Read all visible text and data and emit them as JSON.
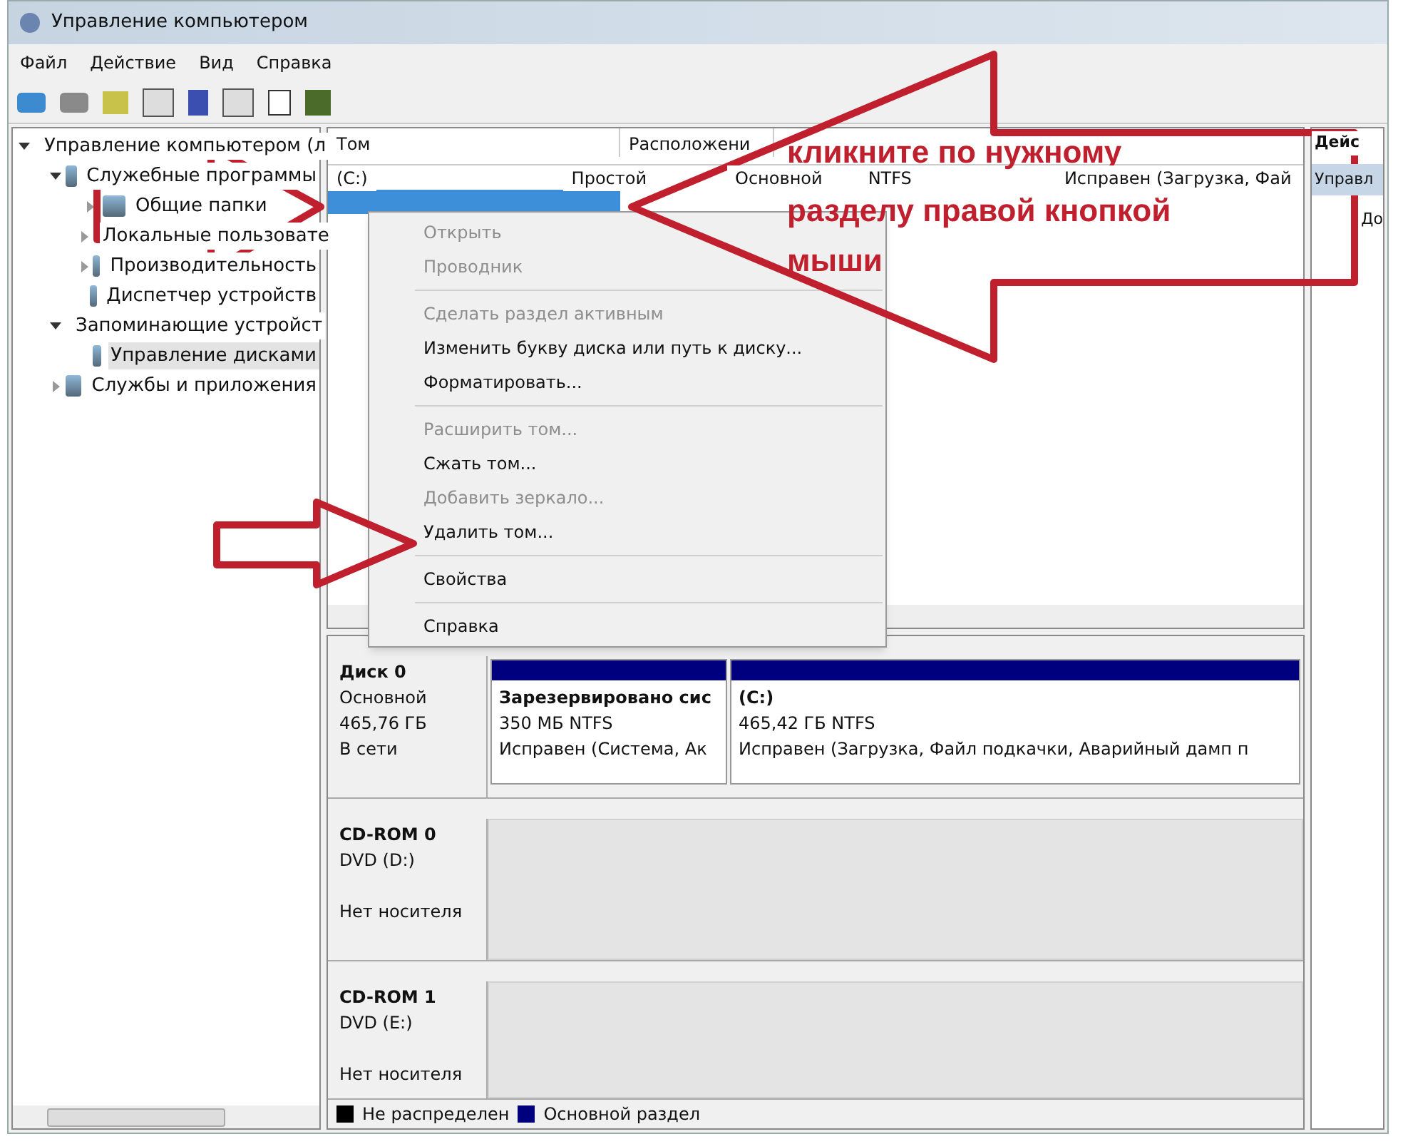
{
  "window": {
    "title": "Управление компьютером"
  },
  "menu_bar": [
    "Файл",
    "Действие",
    "Вид",
    "Справка"
  ],
  "tree": [
    {
      "label": "Управление компьютером (л",
      "expanded": true,
      "children": [
        {
          "label": "Служебные программы",
          "expanded": true,
          "children": [
            {
              "label": "Общие папки",
              "expanded": false
            },
            {
              "label": "Локальные пользовате",
              "expanded": false
            },
            {
              "label": "Производительность",
              "expanded": false
            },
            {
              "label": "Диспетчер устройств"
            }
          ]
        },
        {
          "label": "Запоминающие устройст",
          "expanded": true,
          "children": [
            {
              "label": "Управление дисками",
              "selected": true
            }
          ]
        },
        {
          "label": "Службы и приложения",
          "expanded": false
        }
      ]
    }
  ],
  "volume_table": {
    "columns": [
      "Том",
      "Расположени"
    ],
    "rows": [
      {
        "cells": [
          "(C:)",
          "Простой",
          "Основной",
          "NTFS",
          "Исправен (Загрузка, Фай"
        ],
        "selected": false
      },
      {
        "cells": [],
        "selected": true
      }
    ]
  },
  "actions_panel": {
    "title": "Дейс",
    "items": [
      "Управл",
      "До"
    ]
  },
  "context_menu": [
    {
      "label": "Открыть",
      "disabled": true,
      "separator_after": false
    },
    {
      "label": "Проводник",
      "disabled": true,
      "separator_after": true
    },
    {
      "label": "Сделать раздел активным",
      "disabled": true,
      "separator_after": false
    },
    {
      "label": "Изменить букву диска или путь к диску...",
      "disabled": false,
      "separator_after": false
    },
    {
      "label": "Форматировать...",
      "disabled": false,
      "separator_after": true
    },
    {
      "label": "Расширить том...",
      "disabled": true,
      "separator_after": false
    },
    {
      "label": "Сжать том...",
      "disabled": false,
      "separator_after": false
    },
    {
      "label": "Добавить зеркало...",
      "disabled": true,
      "separator_after": false
    },
    {
      "label": "Удалить том...",
      "disabled": false,
      "separator_after": true
    },
    {
      "label": "Свойства",
      "disabled": false,
      "separator_after": true
    },
    {
      "label": "Справка",
      "disabled": false,
      "separator_after": false
    }
  ],
  "disks": [
    {
      "name": "Диск 0",
      "lines": [
        "Основной",
        "465,76 ГБ",
        "В сети"
      ],
      "partitions": [
        {
          "name": "Зарезервировано сис",
          "lines": [
            "350 МБ NTFS",
            "Исправен (Система, Ак"
          ],
          "color": "#00007f"
        },
        {
          "name": "(C:)",
          "lines": [
            "465,42 ГБ NTFS",
            "Исправен (Загрузка, Файл подкачки, Аварийный дамп п"
          ],
          "color": "#00007f"
        }
      ]
    },
    {
      "name": "CD-ROM 0",
      "lines": [
        "DVD (D:)"
      ],
      "status": "Нет носителя"
    },
    {
      "name": "CD-ROM 1",
      "lines": [
        "DVD (E:)"
      ],
      "status": "Нет носителя"
    }
  ],
  "legend": [
    {
      "label": "Не распределен",
      "color": "#000000"
    },
    {
      "label": "Основной раздел",
      "color": "#00007f"
    }
  ],
  "annotation": [
    "кликните по нужному",
    "разделу правой кнопкой",
    "мыши"
  ]
}
